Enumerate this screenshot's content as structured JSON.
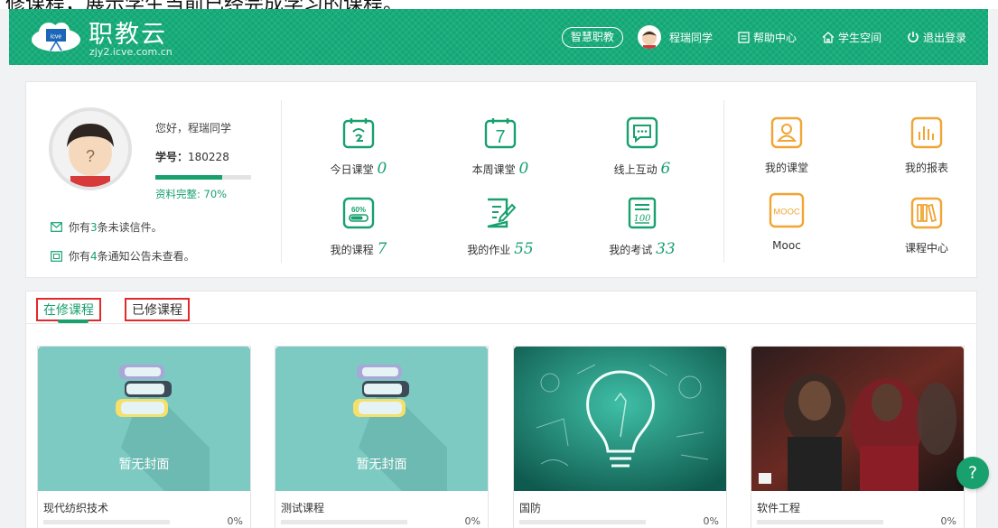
{
  "doc_caption": "修课程，展示学生当前已经完成学习的课程。",
  "header": {
    "title": "职教云",
    "subtitle": "zjy2.icve.com.cn",
    "logo_badge": "icve",
    "pill": "智慧职教",
    "user": "程瑞同学",
    "help": "帮助中心",
    "space": "学生空间",
    "logout": "退出登录"
  },
  "profile": {
    "greeting": "您好，程瑞同学",
    "student_no_label": "学号：",
    "student_no": "180228",
    "completeness_label": "资料完整:  70%",
    "completeness_fraction": 0.7,
    "mail_msg": {
      "pre": "你有",
      "num": "3",
      "post": "条未读信件。"
    },
    "notice_msg": {
      "pre": "你有",
      "num": "4",
      "post": "条通知公告未查看。"
    }
  },
  "stats": [
    {
      "label": "今日课堂",
      "value": "0"
    },
    {
      "label": "本周课堂",
      "value": "0"
    },
    {
      "label": "线上互动",
      "value": "6"
    },
    {
      "label": "我的课程",
      "value": "7"
    },
    {
      "label": "我的作业",
      "value": "55"
    },
    {
      "label": "我的考试",
      "value": "33"
    }
  ],
  "shortcuts": [
    {
      "label": "我的课堂"
    },
    {
      "label": "我的报表"
    },
    {
      "label": "Mooc",
      "icon_text": "MOOC"
    },
    {
      "label": "课程中心"
    }
  ],
  "icons": {
    "week_number": "7",
    "pct_badge": "60%",
    "exam_badge": "100"
  },
  "tabs": [
    {
      "label": "在修课程"
    },
    {
      "label": "已修课程"
    }
  ],
  "courses": [
    {
      "name": "现代纺织技术",
      "progress": "0%",
      "cover_text": "暂无封面"
    },
    {
      "name": "测试课程",
      "progress": "0%",
      "cover_text": "暂无封面"
    },
    {
      "name": "国防",
      "progress": "0%"
    },
    {
      "name": "软件工程",
      "progress": "0%"
    }
  ],
  "help_fab": "?",
  "colors": {
    "brand": "#10a775",
    "accent": "#18a06f",
    "shortcut": "#f0a534",
    "highlight": "#e22a2a"
  }
}
